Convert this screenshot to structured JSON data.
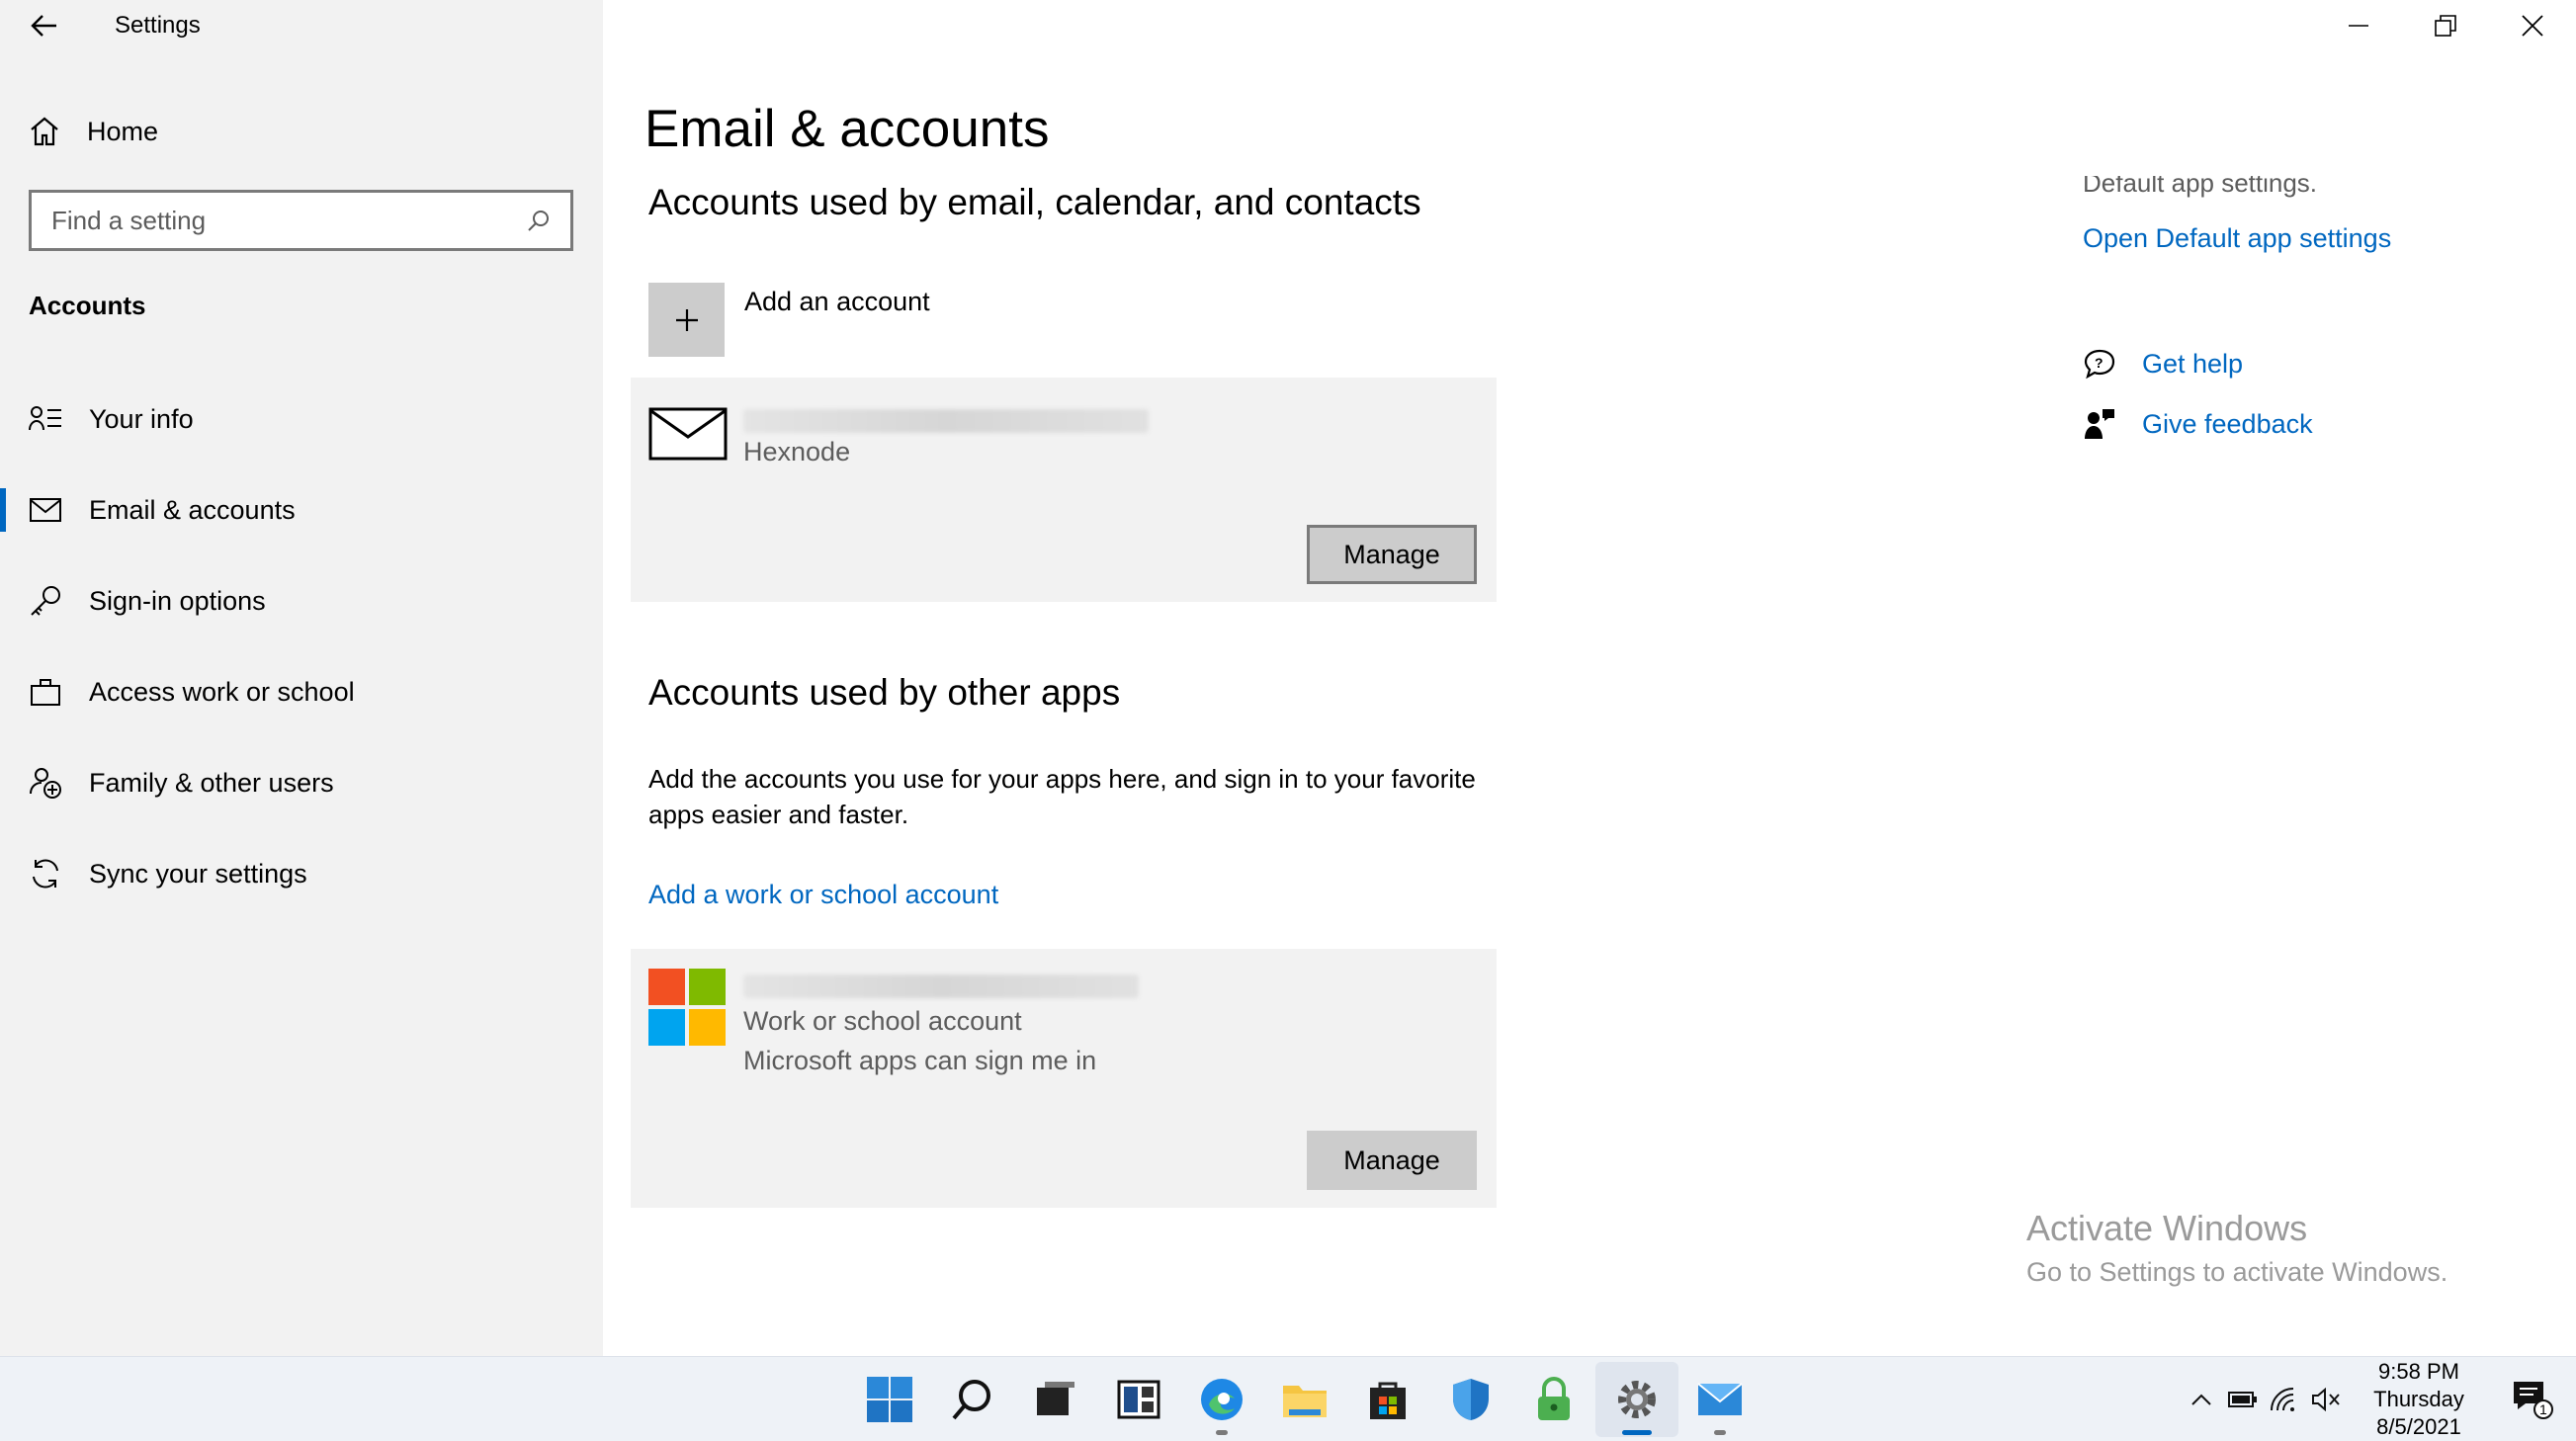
{
  "window": {
    "title": "Settings"
  },
  "sidebar": {
    "home_label": "Home",
    "search_placeholder": "Find a setting",
    "section_label": "Accounts",
    "items": [
      {
        "label": "Your info",
        "icon": "contact-card-icon"
      },
      {
        "label": "Email & accounts",
        "icon": "mail-icon",
        "active": true
      },
      {
        "label": "Sign-in options",
        "icon": "key-icon"
      },
      {
        "label": "Access work or school",
        "icon": "briefcase-icon"
      },
      {
        "label": "Family & other users",
        "icon": "add-person-icon"
      },
      {
        "label": "Sync your settings",
        "icon": "sync-icon"
      }
    ]
  },
  "main": {
    "page_title": "Email & accounts",
    "email_section": {
      "heading": "Accounts used by email, calendar, and contacts",
      "add_account_label": "Add an account",
      "account": {
        "provider": "Hexnode",
        "manage_label": "Manage"
      }
    },
    "other_section": {
      "heading": "Accounts used by other apps",
      "description": "Add the accounts you use for your apps here, and sign in to your favorite apps easier and faster.",
      "add_work_link": "Add a work or school account",
      "account": {
        "type": "Work or school account",
        "detail": "Microsoft apps can sign me in",
        "manage_label": "Manage"
      }
    }
  },
  "related": {
    "faded_text": "Default app settings.",
    "open_default_link": "Open Default app settings",
    "get_help": "Get help",
    "give_feedback": "Give feedback"
  },
  "watermark": {
    "line1": "Activate Windows",
    "line2": "Go to Settings to activate Windows."
  },
  "taskbar": {
    "time": "9:58 PM",
    "day": "Thursday",
    "date": "8/5/2021",
    "notification_count": "1"
  },
  "colors": {
    "accent": "#0067c0",
    "sidebar_bg": "#f2f2f2",
    "card_bg": "#f2f2f2",
    "button_bg": "#cccccc"
  }
}
